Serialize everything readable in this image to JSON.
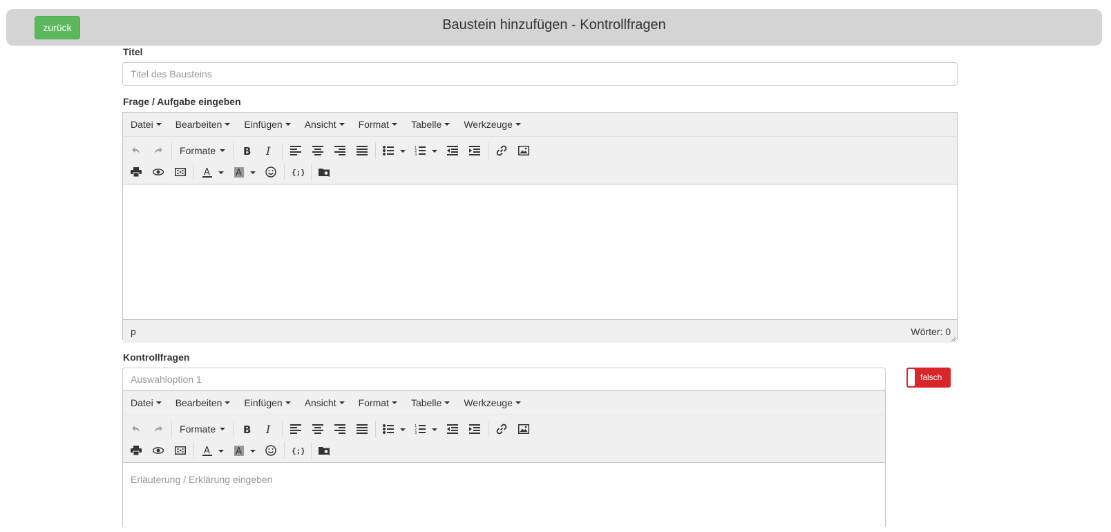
{
  "header": {
    "back_label": "zurück",
    "title": "Baustein hinzufügen - Kontrollfragen"
  },
  "title_field": {
    "label": "Titel",
    "placeholder": "Titel des Bausteins",
    "value": ""
  },
  "question_editor": {
    "label": "Frage / Aufgabe eingeben",
    "menus": [
      "Datei",
      "Bearbeiten",
      "Einfügen",
      "Ansicht",
      "Format",
      "Tabelle",
      "Werkzeuge"
    ],
    "formats_label": "Formate",
    "status_path": "p",
    "word_count": "Wörter: 0"
  },
  "control_questions": {
    "label": "Kontrollfragen",
    "option_placeholder": "Auswahloption 1",
    "option_value": "",
    "toggle_label": "falsch",
    "explanation_placeholder": "Erläuterung / Erklärung eingeben"
  },
  "colors": {
    "header_bg": "#d4d4d4",
    "back_button": "#5cb85c",
    "toggle_false": "#d9262b",
    "toolbar_bg": "#f0f0f0"
  }
}
